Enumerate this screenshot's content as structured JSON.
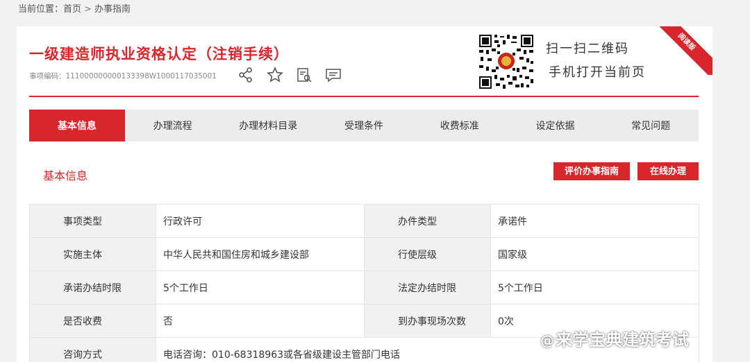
{
  "breadcrumb": {
    "prefix": "当前位置：",
    "home": "首页",
    "separator": ">",
    "current": "办事指南"
  },
  "header": {
    "title": "一级建造师执业资格认定（注销手续）",
    "item_code": "事项编码：111000000000133398W1000117035001",
    "qr_line1": "扫一扫二维码",
    "qr_line2": "手机打开当前页",
    "ribbon": "阅读版"
  },
  "tabs": [
    {
      "label": "基本信息",
      "active": true
    },
    {
      "label": "办理流程",
      "active": false
    },
    {
      "label": "办理材料目录",
      "active": false
    },
    {
      "label": "受理条件",
      "active": false
    },
    {
      "label": "收费标准",
      "active": false
    },
    {
      "label": "设定依据",
      "active": false
    },
    {
      "label": "常见问题",
      "active": false
    }
  ],
  "section": {
    "title": "基本信息",
    "evaluate_button": "评价办事指南",
    "online_button": "在线办理"
  },
  "info_rows": [
    {
      "label1": "事项类型",
      "value1": "行政许可",
      "label2": "办件类型",
      "value2": "承诺件"
    },
    {
      "label1": "实施主体",
      "value1": "中华人民共和国住房和城乡建设部",
      "label2": "行使层级",
      "value2": "国家级"
    },
    {
      "label1": "承诺办结时限",
      "value1": "5个工作日",
      "label2": "法定办结时限",
      "value2": "5个工作日"
    },
    {
      "label1": "是否收费",
      "value1": "否",
      "label2": "到办事现场次数",
      "value2": "0次"
    },
    {
      "label1": "咨询方式",
      "value1": "电话咨询：010-68318963或各省级建设主管部门电话",
      "label2": "",
      "value2": ""
    }
  ],
  "watermark": {
    "at": "@",
    "text": "来学宝典建筑考试"
  },
  "colors": {
    "accent": "#d9262b",
    "tab_bar": "#ececec",
    "label_bg": "#f1f1f1"
  },
  "icons": [
    "share-icon",
    "star-icon",
    "document-search-icon",
    "comment-icon",
    "qr-code-icon"
  ]
}
